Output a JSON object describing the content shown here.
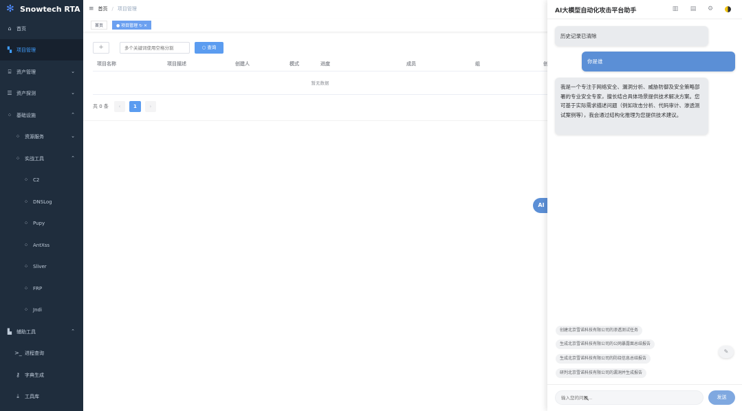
{
  "sidebar": {
    "logo_text": "Snowtech RTA",
    "items": [
      {
        "label": "首页",
        "icon": "dashboard-icon",
        "glyph": "⌂"
      },
      {
        "label": "项目管理",
        "icon": "project-icon",
        "glyph": "▚",
        "active": true
      },
      {
        "label": "资产管理",
        "icon": "bank-icon",
        "glyph": "⌸",
        "chevron": "⌄"
      },
      {
        "label": "资产探测",
        "icon": "server-icon",
        "glyph": "☰",
        "chevron": "⌄"
      },
      {
        "label": "基础设施",
        "icon": "grid-icon",
        "glyph": "⁘",
        "chevron": "⌃"
      },
      {
        "label": "资源服务",
        "icon": "grid-icon",
        "glyph": "⁘",
        "chevron": "⌄"
      },
      {
        "label": "实战工具",
        "icon": "grid-icon",
        "glyph": "⁘",
        "chevron": "⌃"
      },
      {
        "label": "C2",
        "icon": "grid-icon",
        "glyph": "⁘"
      },
      {
        "label": "DNSLog",
        "icon": "grid-icon",
        "glyph": "⁘"
      },
      {
        "label": "Pupy",
        "icon": "grid-icon",
        "glyph": "⁘"
      },
      {
        "label": "AntXss",
        "icon": "grid-icon",
        "glyph": "⁘"
      },
      {
        "label": "Sliver",
        "icon": "grid-icon",
        "glyph": "⁘"
      },
      {
        "label": "FRP",
        "icon": "grid-icon",
        "glyph": "⁘"
      },
      {
        "label": "Jndi",
        "icon": "grid-icon",
        "glyph": "⁘"
      },
      {
        "label": "辅助工具",
        "icon": "toolbox-icon",
        "glyph": "▙",
        "chevron": "⌃"
      },
      {
        "label": "进程查询",
        "icon": "terminal-icon",
        "glyph": ">_"
      },
      {
        "label": "字典生成",
        "icon": "key-icon",
        "glyph": "⚷"
      },
      {
        "label": "工具库",
        "icon": "download-icon",
        "glyph": "⤓"
      }
    ]
  },
  "topbar": {
    "breadcrumb": [
      "首页",
      "项目管理"
    ]
  },
  "tags": [
    {
      "label": "首页"
    },
    {
      "label": "● 项目管理 ↻ ✕",
      "active": true
    }
  ],
  "toolbar": {
    "add_label": "+",
    "search_placeholder": "多个关键词使用空格分割",
    "search_button": "○ 查询"
  },
  "table": {
    "columns": [
      "项目名称",
      "项目描述",
      "创建人",
      "模式",
      "进度",
      "成员",
      "组",
      "创"
    ],
    "empty_text": "暂无数据"
  },
  "pagination": {
    "total_text": "共 0 条",
    "prev": "‹",
    "current": "1",
    "next": "›"
  },
  "ai_float": "AI",
  "chat": {
    "title": "AI大模型自动化攻击平台助手",
    "header_icons": [
      "trash-icon",
      "document-icon",
      "gear-icon",
      "theme-toggle-icon"
    ],
    "messages": [
      {
        "role": "system",
        "text": "历史记录已清除"
      },
      {
        "role": "user",
        "text": "你是谁"
      },
      {
        "role": "assistant",
        "text": "我是一个专注于网络安全、漏洞分析、威胁防御及安全策略部署的专业安全专家，擅长结合具体场景提供技术解决方案。您可基于实际需求描述问题（例如攻击分析、代码审计、渗透测试案例等），我会通过结构化推理为您提供技术建议。"
      }
    ],
    "suggestions": [
      "创建北京雪诺科技有限公司的渗透测试任务",
      "生成北京雪诺科技有限公司的公网暴露面总结报告",
      "生成北京雪诺科技有限公司的防绕信息总结报告",
      "研判北京雪诺科技有限公司的漏洞并生成报告"
    ],
    "input_placeholder": "输入您的问题...",
    "send_label": "发送"
  }
}
